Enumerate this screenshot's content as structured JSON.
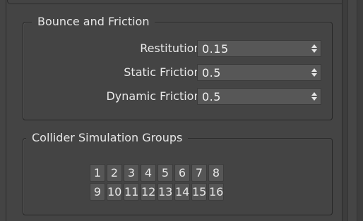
{
  "bounce_friction": {
    "title": "Bounce and Friction",
    "fields": [
      {
        "label": "Restitution:",
        "value": "0.15"
      },
      {
        "label": "Static Friction:",
        "value": "0.5"
      },
      {
        "label": "Dynamic Friction:",
        "value": "0.5"
      }
    ]
  },
  "collider_groups": {
    "title": "Collider Simulation Groups",
    "buttons": [
      "1",
      "2",
      "3",
      "4",
      "5",
      "6",
      "7",
      "8",
      "9",
      "10",
      "11",
      "12",
      "13",
      "14",
      "15",
      "16"
    ]
  },
  "icons": {
    "spinner_arrows": "up-down-arrows-icon"
  }
}
